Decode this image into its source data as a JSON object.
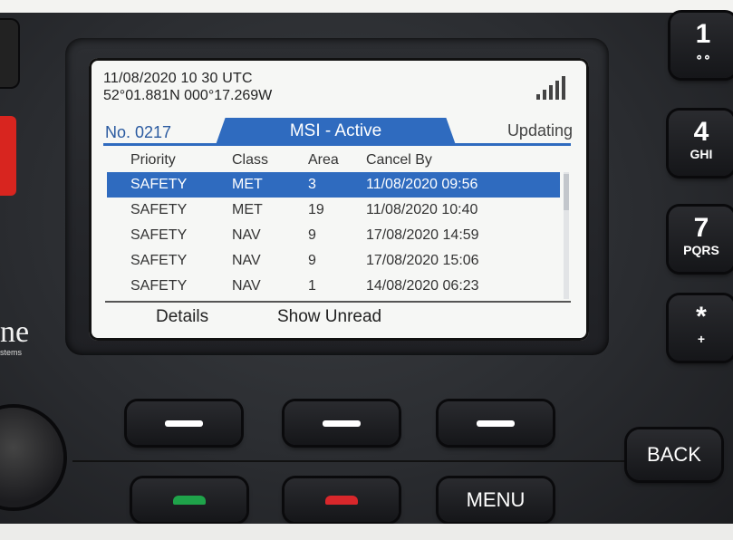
{
  "status": {
    "datetime": "11/08/2020 10 30 UTC",
    "position": "52°01.881N 000°17.269W",
    "signal_icon": "signal-bars-icon"
  },
  "tabbar": {
    "message_number": "No. 0217",
    "active_tab": "MSI - Active",
    "status": "Updating"
  },
  "table": {
    "headers": [
      "Priority",
      "Class",
      "Area",
      "Cancel By"
    ],
    "rows": [
      {
        "priority": "SAFETY",
        "class": "MET",
        "area": "3",
        "cancel_by": "11/08/2020 09:56",
        "selected": true
      },
      {
        "priority": "SAFETY",
        "class": "MET",
        "area": "19",
        "cancel_by": "11/08/2020 10:40",
        "selected": false
      },
      {
        "priority": "SAFETY",
        "class": "NAV",
        "area": "9",
        "cancel_by": "17/08/2020 14:59",
        "selected": false
      },
      {
        "priority": "SAFETY",
        "class": "NAV",
        "area": "9",
        "cancel_by": "17/08/2020 15:06",
        "selected": false
      },
      {
        "priority": "SAFETY",
        "class": "NAV",
        "area": "1",
        "cancel_by": "14/08/2020 06:23",
        "selected": false
      }
    ]
  },
  "softkeys": {
    "left": "Details",
    "middle": "Show Unread"
  },
  "hardware": {
    "menu": "MENU",
    "back": "BACK",
    "key1": {
      "digit": "1",
      "sub": "voicemail-icon"
    },
    "key4": {
      "digit": "4",
      "sub": "GHI"
    },
    "key7": {
      "digit": "7",
      "sub": "PQRS"
    },
    "key_star": {
      "digit": "*",
      "sub": "+"
    },
    "brand_partial": "ne",
    "brand_sub_partial": "stems"
  },
  "colors": {
    "accent": "#2f6bbf",
    "screen_bg": "#f6f7f5",
    "call_green": "#1fa34a",
    "end_red": "#d9272b"
  }
}
